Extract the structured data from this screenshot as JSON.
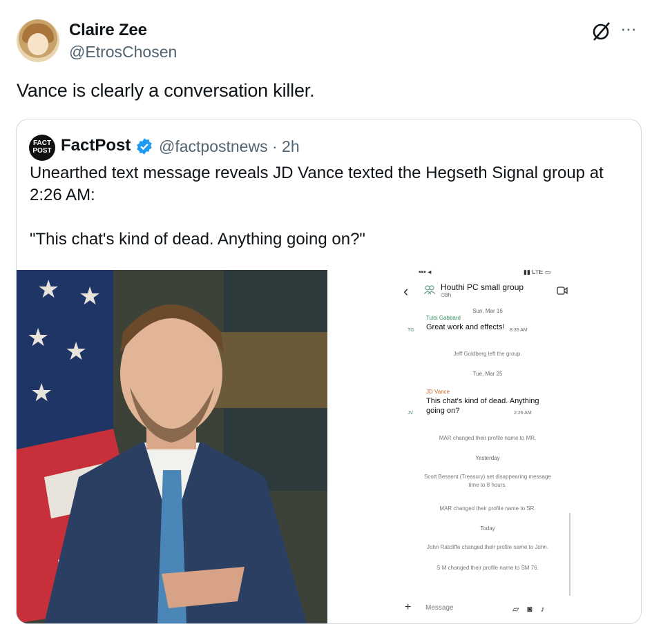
{
  "author": {
    "name": "Claire Zee",
    "handle": "@EtrosChosen"
  },
  "tweet": {
    "text": "Vance is clearly a conversation killer."
  },
  "quote": {
    "logo_text": "FACT POST",
    "name": "FactPost",
    "meta": "@factpostnews · 2h",
    "text": "Unearthed text message reveals JD Vance texted the Hegseth Signal group at 2:26 AM:\n\n\"This chat's kind of dead. Anything going on?\""
  },
  "chat": {
    "group_title": "Houthi PC small group",
    "group_sub": "⏱8h",
    "day1": "Sun, Mar 16",
    "sender1": "Tulsi Gabbard",
    "initials1": "TG",
    "msg1": "Great work and effects!",
    "time1": "8:35 AM",
    "sys1": "Jeff Goldberg left the group.",
    "day2": "Tue, Mar 25",
    "sender2": "JD Vance",
    "initials2": "JV",
    "msg2": "This chat's kind of dead. Anything going on?",
    "time2": "2:26 AM",
    "sys2": "MAR changed their profile name to MR.",
    "day3": "Yesterday",
    "sys3": "Scott Bessent (Treasury) set disappearing message time to 8 hours.",
    "sys4": "MAR changed their profile name to SR.",
    "day4": "Today",
    "sys5": "John Ratcliffe changed their profile name to John.",
    "sys6": "S M changed their profile name to SM 76.",
    "composer_placeholder": "Message"
  },
  "colors": {
    "verified": "#1d9bf0",
    "muted": "#536471",
    "border": "#cfd9de",
    "tulsi": "#2f8f57",
    "vance": "#c8642a"
  }
}
